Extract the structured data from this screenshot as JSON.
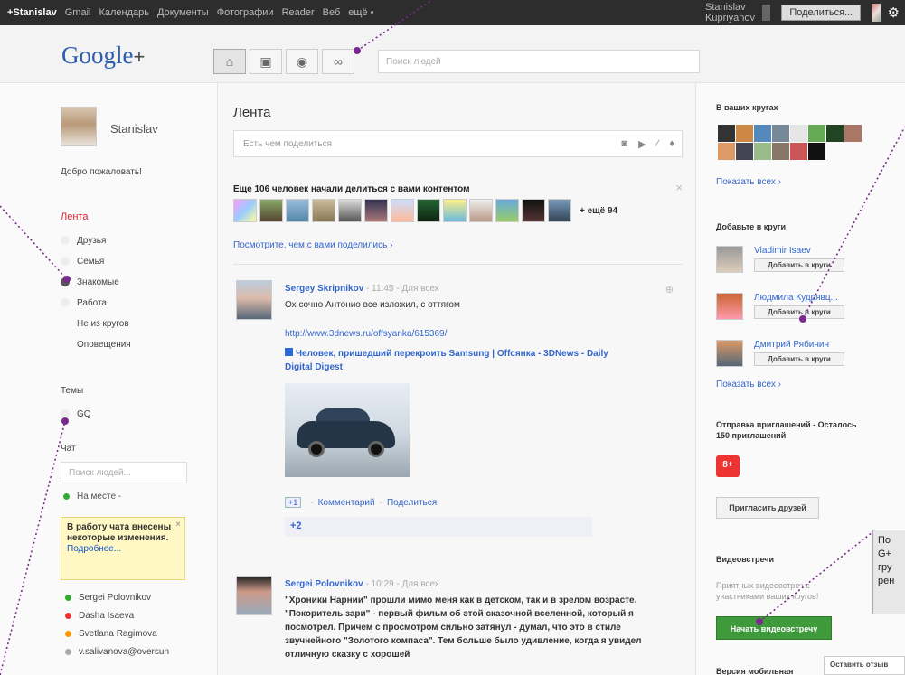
{
  "topbar": {
    "links": [
      "+Stanislav",
      "Gmail",
      "Календарь",
      "Документы",
      "Фотографии",
      "Reader",
      "Веб",
      "ещё •"
    ],
    "user_name": "Stanislav Kupriyanov",
    "share_label": "Поделиться..."
  },
  "header": {
    "logo": "Google",
    "logo_plus": "+",
    "search_placeholder": "Поиск людей",
    "nav_icons": [
      "home-icon",
      "photos-icon",
      "profile-icon",
      "circles-icon"
    ]
  },
  "left": {
    "profile_name": "Stanislav",
    "welcome": "Добро пожаловать!",
    "streams_header": "Лента",
    "streams": [
      {
        "label": "Друзья"
      },
      {
        "label": "Семья"
      },
      {
        "label": "Знакомые"
      },
      {
        "label": "Работа"
      },
      {
        "label": "Не из кругов"
      },
      {
        "label": "Оповещения"
      }
    ],
    "topics_header": "Темы",
    "topic": "GQ",
    "chat_header": "Чат",
    "chat_search_placeholder": "Поиск людей...",
    "status": "На месте -",
    "chat_notice": "В работу чата внесены некоторые изменения.",
    "chat_notice_more": "Подробнее...",
    "contacts": [
      {
        "name": "Sergei Polovnikov",
        "color": "#3a3"
      },
      {
        "name": "Dasha Isaeva",
        "color": "#e33"
      },
      {
        "name": "Svetlana Ragimova",
        "color": "#f90"
      },
      {
        "name": "v.salivanova@oversun",
        "color": "#aaa"
      }
    ]
  },
  "center": {
    "feed_title": "Лента",
    "share_placeholder": "Есть чем поделиться",
    "suggest_title": "Еще 106 человек начали делиться с вами контентом",
    "suggest_more": "+ ещё 94",
    "see_share": "Посмотрите, чем с вами поделились ›",
    "posts": [
      {
        "author": "Sergey Skripnikov",
        "time": "11:45",
        "visibility": "Для всех",
        "text": "Ох сочно Антонио все изложил, с оттягом",
        "link": "http://www.3dnews.ru/offsyanka/615369/",
        "card_title": "Человек, пришедший перекроить Samsung | Offсянка - 3DNews - Daily Digital Digest",
        "actions": [
          "+1",
          "Комментарий",
          "Поделиться"
        ],
        "plus_count": "+2"
      },
      {
        "author": "Sergei Polovnikov",
        "time": "10:29",
        "visibility": "Для всех",
        "text": "\"Хроники Нарнии\" прошли мимо меня как в детском, так и в зрелом возрасте. \"Покоритель зари\" - первый фильм об этой сказочной вселенной, который я посмотрел. Причем с просмотром сильно затянул - думал, что это в стиле звучнейного \"Золотого компаса\". Тем больше было удивление, когда я увидел отличную сказку с хорошей"
      }
    ]
  },
  "right": {
    "in_circles_header": "В ваших кругах",
    "show_all": "Показать всех ›",
    "add_header": "Добавьте в круги",
    "suggestions": [
      {
        "name": "Vladimir Isaev",
        "button": "Добавить в круги"
      },
      {
        "name": "Людмила Кудрявц...",
        "button": "Добавить в круги"
      },
      {
        "name": "Дмитрий Рябинин",
        "button": "Добавить в круги"
      }
    ],
    "show_all_2": "Показать всех ›",
    "invites": "Отправка приглашений - Осталось 150 приглашений",
    "gplus_icon": "8+",
    "invite_button": "Пригласить друзей",
    "video_header": "Видеовстречи",
    "video_desc": "Приятных видеовстреч с участниками ваших кругов!",
    "hangout_button": "Начать видеовстречу",
    "mobile_header": "Версия мобильная",
    "feedback": "Оставить отзыв"
  },
  "callout": {
    "lines": [
      "По",
      "G+",
      "гру",
      "рен"
    ]
  }
}
